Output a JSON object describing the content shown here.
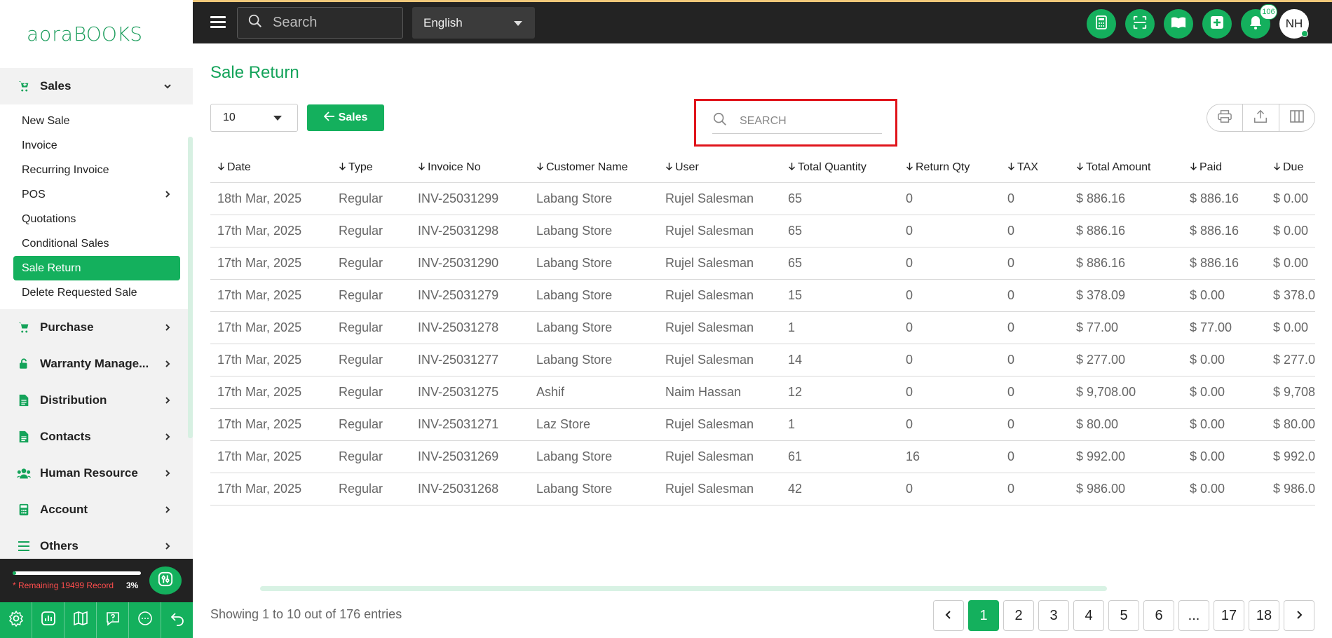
{
  "logo": {
    "part1": "aora",
    "part2": "BOOKS"
  },
  "topbar": {
    "search_placeholder": "Search",
    "language": "English",
    "notification_count": "106",
    "avatar_initials": "NH"
  },
  "sidebar": {
    "sales_label": "Sales",
    "sales_items": [
      "New Sale",
      "Invoice",
      "Recurring Invoice",
      "POS",
      "Quotations",
      "Conditional Sales",
      "Sale Return",
      "Delete Requested Sale"
    ],
    "active_item": "Sale Return",
    "sections": [
      "Purchase",
      "Warranty Manage...",
      "Distribution",
      "Contacts",
      "Human Resource",
      "Account",
      "Others"
    ]
  },
  "footer": {
    "remaining_text": "* Remaining 19499 Record",
    "percent": "3%",
    "progress_fraction": 0.03
  },
  "main": {
    "title": "Sale Return",
    "page_size": "10",
    "sales_button": "Sales",
    "search_placeholder": "SEARCH"
  },
  "table": {
    "columns": [
      "Date",
      "Type",
      "Invoice No",
      "Customer Name",
      "User",
      "Total Quantity",
      "Return Qty",
      "TAX",
      "Total Amount",
      "Paid",
      "Due"
    ],
    "rows": [
      [
        "18th Mar, 2025",
        "Regular",
        "INV-25031299",
        "Labang Store",
        "Rujel Salesman",
        "65",
        "0",
        "0",
        "$ 886.16",
        "$ 886.16",
        "$ 0.00"
      ],
      [
        "17th Mar, 2025",
        "Regular",
        "INV-25031298",
        "Labang Store",
        "Rujel Salesman",
        "65",
        "0",
        "0",
        "$ 886.16",
        "$ 886.16",
        "$ 0.00"
      ],
      [
        "17th Mar, 2025",
        "Regular",
        "INV-25031290",
        "Labang Store",
        "Rujel Salesman",
        "65",
        "0",
        "0",
        "$ 886.16",
        "$ 886.16",
        "$ 0.00"
      ],
      [
        "17th Mar, 2025",
        "Regular",
        "INV-25031279",
        "Labang Store",
        "Rujel Salesman",
        "15",
        "0",
        "0",
        "$ 378.09",
        "$ 0.00",
        "$ 378.0"
      ],
      [
        "17th Mar, 2025",
        "Regular",
        "INV-25031278",
        "Labang Store",
        "Rujel Salesman",
        "1",
        "0",
        "0",
        "$ 77.00",
        "$ 77.00",
        "$ 0.00"
      ],
      [
        "17th Mar, 2025",
        "Regular",
        "INV-25031277",
        "Labang Store",
        "Rujel Salesman",
        "14",
        "0",
        "0",
        "$ 277.00",
        "$ 0.00",
        "$ 277.0"
      ],
      [
        "17th Mar, 2025",
        "Regular",
        "INV-25031275",
        "Ashif",
        "Naim Hassan",
        "12",
        "0",
        "0",
        "$ 9,708.00",
        "$ 0.00",
        "$ 9,708"
      ],
      [
        "17th Mar, 2025",
        "Regular",
        "INV-25031271",
        "Laz Store",
        "Rujel Salesman",
        "1",
        "0",
        "0",
        "$ 80.00",
        "$ 0.00",
        "$ 80.00"
      ],
      [
        "17th Mar, 2025",
        "Regular",
        "INV-25031269",
        "Labang Store",
        "Rujel Salesman",
        "61",
        "16",
        "0",
        "$ 992.00",
        "$ 0.00",
        "$ 992.0"
      ],
      [
        "17th Mar, 2025",
        "Regular",
        "INV-25031268",
        "Labang Store",
        "Rujel Salesman",
        "42",
        "0",
        "0",
        "$ 986.00",
        "$ 0.00",
        "$ 986.0"
      ]
    ]
  },
  "pagination": {
    "entries_text": "Showing 1 to 10 out of 176 entries",
    "pages": [
      "1",
      "2",
      "3",
      "4",
      "5",
      "6",
      "...",
      "17",
      "18"
    ],
    "active_page": "1"
  },
  "colors": {
    "accent": "#14b05d",
    "highlight": "#e0141b",
    "topbar": "#232323"
  }
}
